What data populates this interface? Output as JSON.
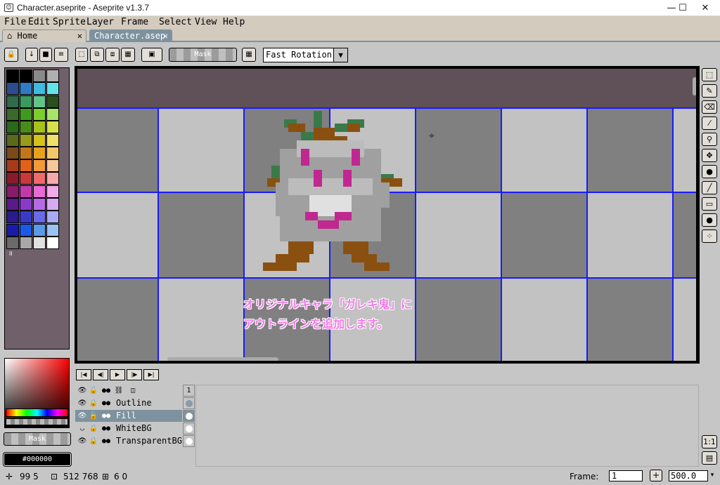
{
  "window": {
    "title": "Character.aseprite - Aseprite v1.3.7",
    "minimize": "—",
    "maximize": "☐",
    "close": "✕"
  },
  "menu": [
    "File",
    "Edit",
    "Sprite",
    "Layer",
    "Frame",
    "Select",
    "View",
    "Help"
  ],
  "tabs": {
    "home_label": "Home",
    "active_label": "Character.asep",
    "close_glyph": "✕"
  },
  "toolbar": {
    "mask_label": "Mask",
    "rotation_algorithm": "Fast Rotation"
  },
  "palette": {
    "colors": [
      "#000000",
      "#000000",
      "#8a8a8a",
      "#b0b0b0",
      "#2b4d8e",
      "#2f7cc4",
      "#3fbbe0",
      "#63e3e8",
      "#2f6a4a",
      "#3c9a5e",
      "#63c48a",
      "#2a4f1e",
      "#3a6a2a",
      "#3f9a1f",
      "#7bcf2a",
      "#a8e36a",
      "#2a6a1a",
      "#4a8a1a",
      "#a8c21a",
      "#d6e04a",
      "#5a6a1a",
      "#9a9a1a",
      "#d6c21a",
      "#efe06a",
      "#7a4a1a",
      "#c2781a",
      "#e8a21a",
      "#f2c86a",
      "#a83a1a",
      "#e0621a",
      "#f29a3a",
      "#f7c89a",
      "#8a1a2a",
      "#c83a3a",
      "#ef6a6a",
      "#f7aaaa",
      "#8a1a6a",
      "#c23aa8",
      "#e86ad6",
      "#f2aae8",
      "#5a1a8a",
      "#8a3ac8",
      "#b66ae8",
      "#d6aaf2",
      "#2a1a8a",
      "#3a3ac8",
      "#6a6ae8",
      "#aaaaf2",
      "#1a1aa8",
      "#1a5ae8",
      "#5a9ae8",
      "#9ac2f2",
      "#6a6a6a",
      "#a8a8a8",
      "#e0e0e0",
      "#ffffff"
    ],
    "pause_glyph": "II"
  },
  "color_bar": {
    "mask_label": "Mask",
    "hex_value": "#000000"
  },
  "canvas": {
    "annotation_line1": "オリジナルキャラ「ガレキ鬼」に",
    "annotation_line2": "アウトラインを追加します。"
  },
  "timeline": {
    "frame_header": "1",
    "layers": [
      {
        "name": "Outline"
      },
      {
        "name": "Fill"
      },
      {
        "name": "WhiteBG"
      },
      {
        "name": "TransparentBG"
      }
    ]
  },
  "status": {
    "cursor": "99 5",
    "sprite_size": "512 768",
    "grid": "6 0",
    "frame_label": "Frame:",
    "frame_value": "1",
    "add_frame": "+",
    "zoom_value": "500.0"
  }
}
